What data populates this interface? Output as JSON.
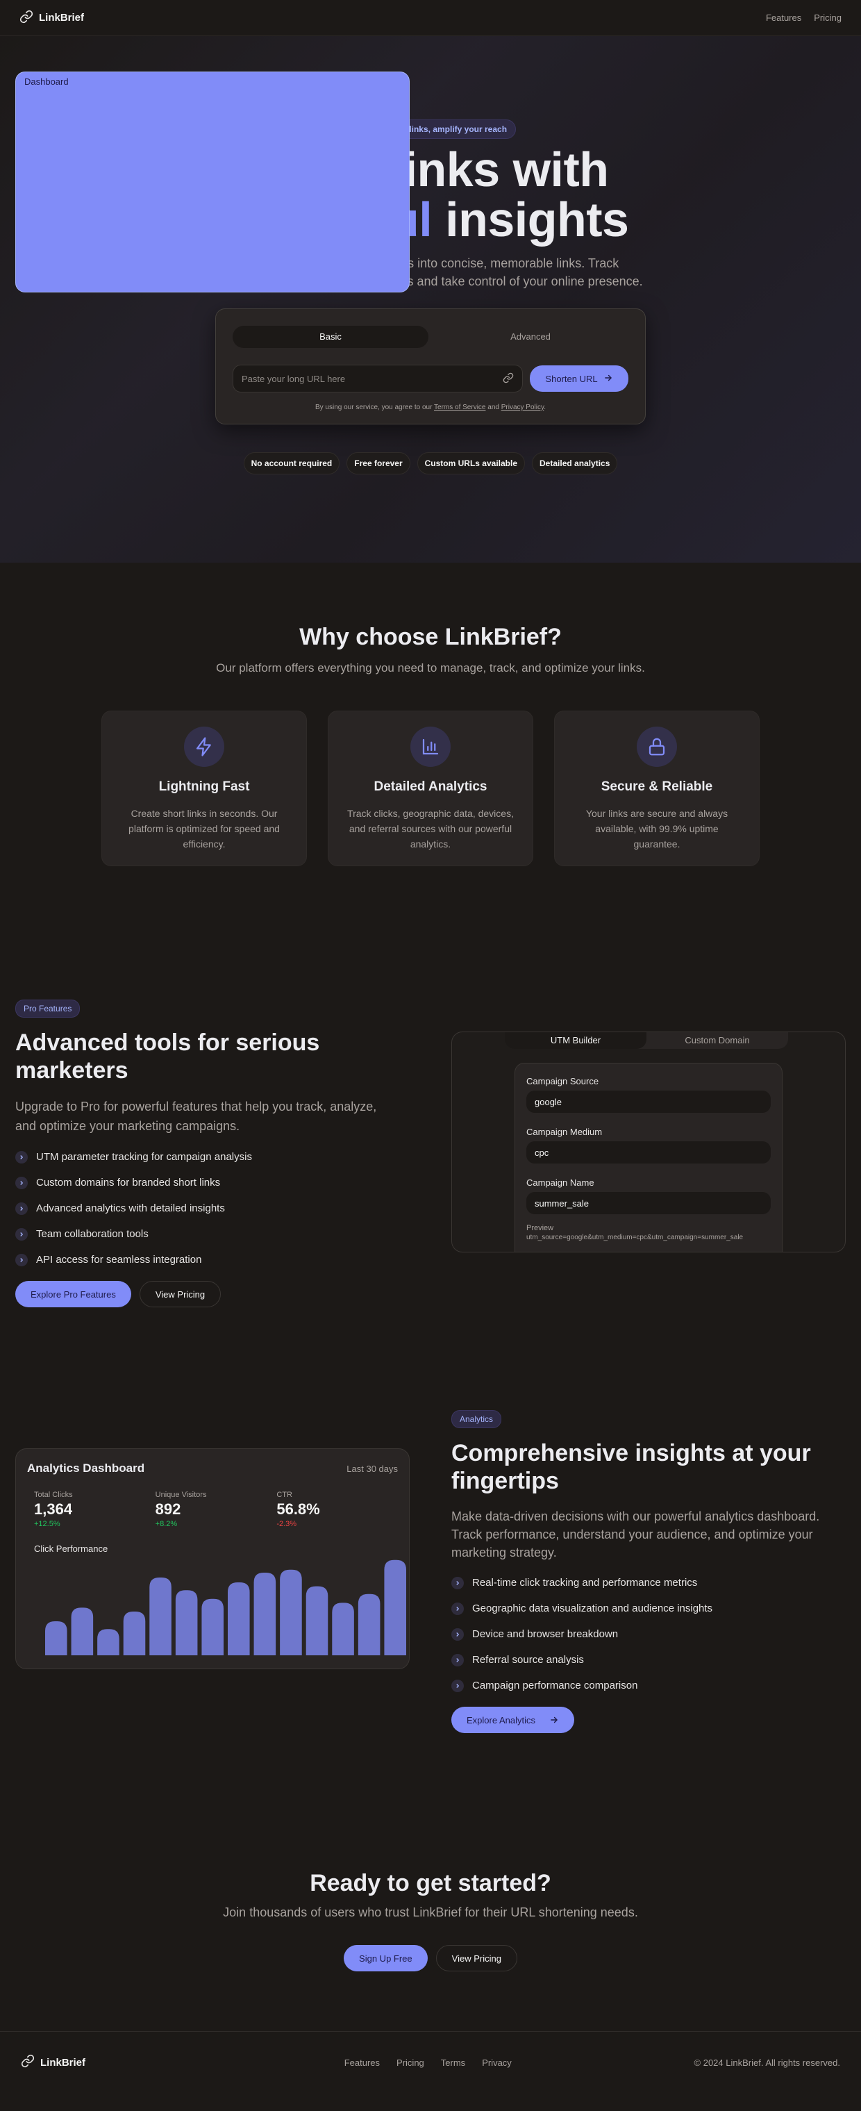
{
  "nav": {
    "brand": "LinkBrief",
    "links": [
      "Features",
      "Pricing"
    ],
    "dashboard": "Dashboard"
  },
  "hero": {
    "pill": "Simplify your links, amplify your reach",
    "title_line1": "Short links with",
    "title_accent": "powerful",
    "title_rest": " insights",
    "subtitle": "Transform long, complex URLs into concise, memorable links. Track performance with detailed analytics and take control of your online presence.",
    "tabs": [
      "Basic",
      "Advanced"
    ],
    "input_placeholder": "Paste your long URL here",
    "shorten_label": "Shorten URL",
    "terms_prefix": "By using our service, you agree to our ",
    "terms_link": "Terms of Service",
    "terms_and": " and ",
    "privacy_link": "Privacy Policy",
    "terms_suffix": ".",
    "badges": [
      "No account required",
      "Free forever",
      "Custom URLs available",
      "Detailed analytics"
    ]
  },
  "why": {
    "title": "Why choose LinkBrief?",
    "subtitle": "Our platform offers everything you need to manage, track, and optimize your links.",
    "features": [
      {
        "icon": "lightning-icon",
        "title": "Lightning Fast",
        "text": "Create short links in seconds. Our platform is optimized for speed and efficiency."
      },
      {
        "icon": "bar-chart-icon",
        "title": "Detailed Analytics",
        "text": "Track clicks, geographic data, devices, and referral sources with our powerful analytics."
      },
      {
        "icon": "lock-icon",
        "title": "Secure & Reliable",
        "text": "Your links are secure and always available, with 99.9% uptime guarantee."
      }
    ]
  },
  "pro": {
    "pill": "Pro Features",
    "title": "Advanced tools for serious marketers",
    "subtitle": "Upgrade to Pro for powerful features that help you track, analyze, and optimize your marketing campaigns.",
    "items": [
      "UTM parameter tracking for campaign analysis",
      "Custom domains for branded short links",
      "Advanced analytics with detailed insights",
      "Team collaboration tools",
      "API access for seamless integration"
    ],
    "primary_btn": "Explore Pro Features",
    "secondary_btn": "View Pricing",
    "utm": {
      "tabs": [
        "UTM Builder",
        "Custom Domain"
      ],
      "fields": [
        {
          "label": "Campaign Source",
          "value": "google"
        },
        {
          "label": "Campaign Medium",
          "value": "cpc"
        },
        {
          "label": "Campaign Name",
          "value": "summer_sale"
        }
      ],
      "preview_label": "Preview",
      "preview_value": "utm_source=google&utm_medium=cpc&utm_campaign=summer_sale"
    }
  },
  "analytics": {
    "dashboard_title": "Analytics Dashboard",
    "range": "Last 30 days",
    "stats": [
      {
        "label": "Total Clicks",
        "value": "1,364",
        "delta": "+12.5%",
        "trend": "up"
      },
      {
        "label": "Unique Visitors",
        "value": "892",
        "delta": "+8.2%",
        "trend": "up"
      },
      {
        "label": "CTR",
        "value": "56.8%",
        "delta": "-2.3%",
        "trend": "down"
      }
    ],
    "chart_title": "Click Performance",
    "pill": "Analytics",
    "title": "Comprehensive insights at your fingertips",
    "subtitle": "Make data-driven decisions with our powerful analytics dashboard. Track performance, understand your audience, and optimize your marketing strategy.",
    "items": [
      "Real-time click tracking and performance metrics",
      "Geographic data visualization and audience insights",
      "Device and browser breakdown",
      "Referral source analysis",
      "Campaign performance comparison"
    ],
    "btn": "Explore Analytics",
    "accent": "#818cf8"
  },
  "chart_data": {
    "type": "bar",
    "title": "Click Performance",
    "values": [
      35,
      49,
      27,
      45,
      80,
      67,
      58,
      75,
      85,
      88,
      71,
      54,
      63,
      98
    ],
    "ylim": [
      0,
      100
    ]
  },
  "cta": {
    "title": "Ready to get started?",
    "subtitle": "Join thousands of users who trust LinkBrief for their URL shortening needs.",
    "primary": "Sign Up Free",
    "secondary": "View Pricing"
  },
  "footer": {
    "brand": "LinkBrief",
    "links": [
      "Features",
      "Pricing",
      "Terms",
      "Privacy"
    ],
    "copyright": "© 2024 LinkBrief. All rights reserved."
  }
}
